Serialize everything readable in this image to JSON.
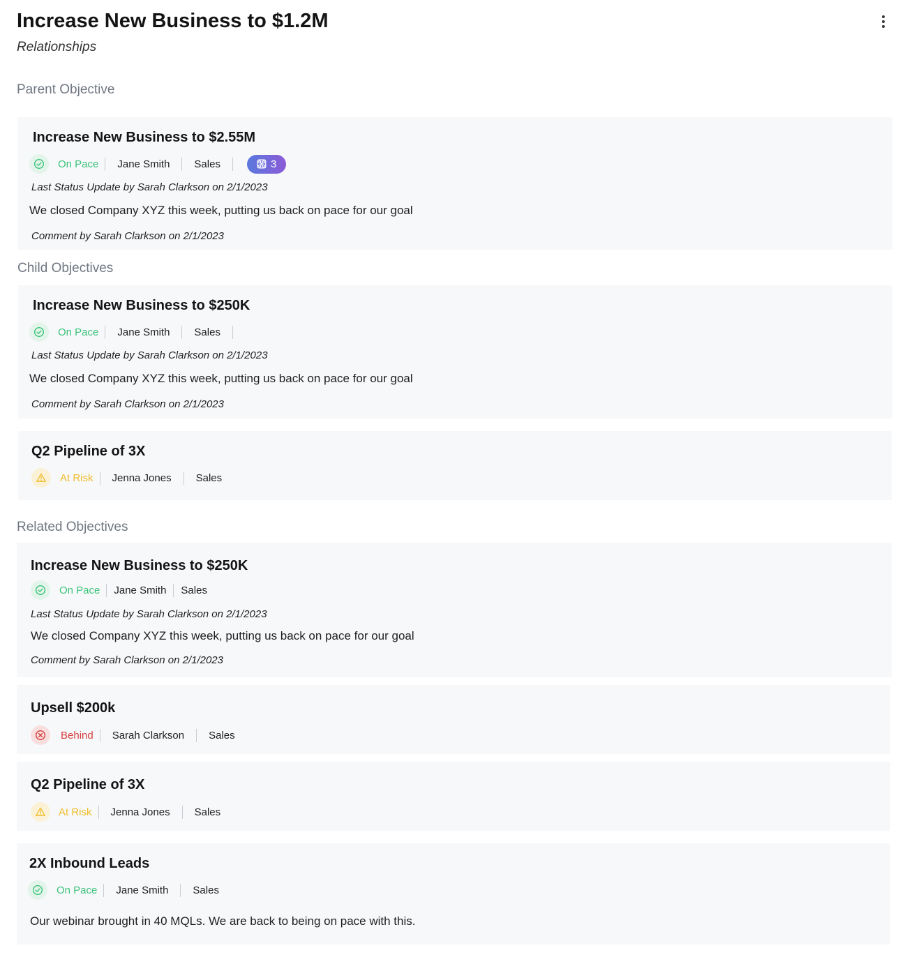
{
  "header": {
    "title": "Increase New Business to $1.2M",
    "subtitle": "Relationships",
    "menu_icon": "more-vertical-icon"
  },
  "colors": {
    "on_pace": "#3cc37a",
    "at_risk": "#f1bc2a",
    "behind": "#d53c3c",
    "badge_gradient_start": "#5a79de",
    "badge_gradient_end": "#8b5bd6",
    "card_bg": "#f7f8fa"
  },
  "sections": {
    "parent": "Parent Objective",
    "child": "Child Objectives",
    "related": "Related Objectives"
  },
  "parent": {
    "title": "Increase New Business to $2.55M",
    "status": "On Pace",
    "status_icon": "check-circle-icon",
    "owner": "Jane Smith",
    "team": "Sales",
    "badge_icon": "link-nodes-icon",
    "badge_count": "3",
    "last_update": "Last Status Update by Sarah Clarkson on 2/1/2023",
    "update_text": "We closed Company XYZ this week, putting us back on pace for our goal",
    "comment": "Comment by Sarah Clarkson on 2/1/2023"
  },
  "children": [
    {
      "title": "Increase New Business to $250K",
      "status": "On Pace",
      "status_icon": "check-circle-icon",
      "owner": "Jane Smith",
      "team": "Sales",
      "last_update": "Last Status Update by Sarah Clarkson on 2/1/2023",
      "update_text": "We closed Company XYZ this week, putting us back on pace for our goal",
      "comment": "Comment by Sarah Clarkson on 2/1/2023"
    },
    {
      "title": "Q2 Pipeline of 3X",
      "status": "At Risk",
      "status_icon": "warning-triangle-icon",
      "owner": "Jenna Jones",
      "team": "Sales"
    }
  ],
  "related": [
    {
      "title": "Increase New Business to $250K",
      "status": "On Pace",
      "status_icon": "check-circle-icon",
      "owner": "Jane Smith",
      "team": "Sales",
      "last_update": "Last Status Update by Sarah Clarkson on 2/1/2023",
      "update_text": "We closed Company XYZ this week, putting us back on pace for our goal",
      "comment": "Comment by Sarah Clarkson on 2/1/2023"
    },
    {
      "title": "Upsell $200k",
      "status": "Behind",
      "status_icon": "x-circle-icon",
      "owner": "Sarah Clarkson",
      "team": "Sales"
    },
    {
      "title": "Q2 Pipeline of 3X",
      "status": "At Risk",
      "status_icon": "warning-triangle-icon",
      "owner": "Jenna Jones",
      "team": "Sales"
    },
    {
      "title": "2X Inbound Leads",
      "status": "On Pace",
      "status_icon": "check-circle-icon",
      "owner": "Jane Smith",
      "team": "Sales",
      "update_text": "Our webinar brought in 40 MQLs. We are back to being on pace with this."
    }
  ]
}
